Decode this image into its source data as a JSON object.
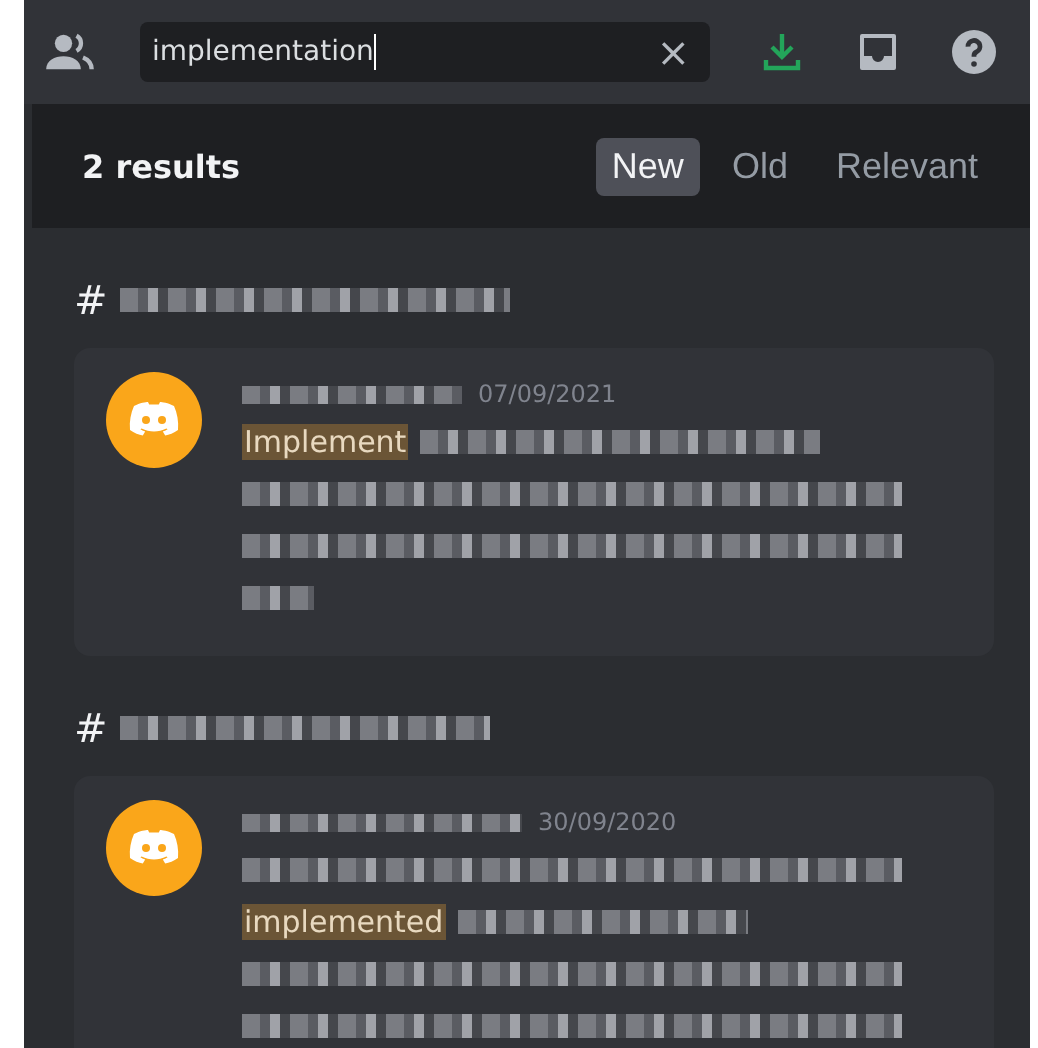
{
  "toolbar": {
    "search": {
      "value": "implementation",
      "clear": "×"
    }
  },
  "results_header": {
    "count": "2 results",
    "sort_tabs": [
      {
        "label": "New",
        "selected": true
      },
      {
        "label": "Old",
        "selected": false
      },
      {
        "label": "Relevant",
        "selected": false
      }
    ]
  },
  "results": [
    {
      "channel_icon": "#",
      "message": {
        "date": "07/09/2021",
        "lines": [
          [
            {
              "kind": "highlight",
              "text": "Implement"
            },
            {
              "kind": "redacted"
            }
          ],
          [
            {
              "kind": "redacted"
            }
          ],
          [
            {
              "kind": "redacted"
            }
          ],
          [
            {
              "kind": "redacted"
            }
          ]
        ]
      }
    },
    {
      "channel_icon": "#",
      "message": {
        "date": "30/09/2020",
        "lines": [
          [
            {
              "kind": "redacted"
            }
          ],
          [
            {
              "kind": "highlight",
              "text": "implemented"
            },
            {
              "kind": "redacted"
            }
          ],
          [
            {
              "kind": "redacted"
            }
          ],
          [
            {
              "kind": "redacted"
            }
          ]
        ]
      }
    }
  ]
}
